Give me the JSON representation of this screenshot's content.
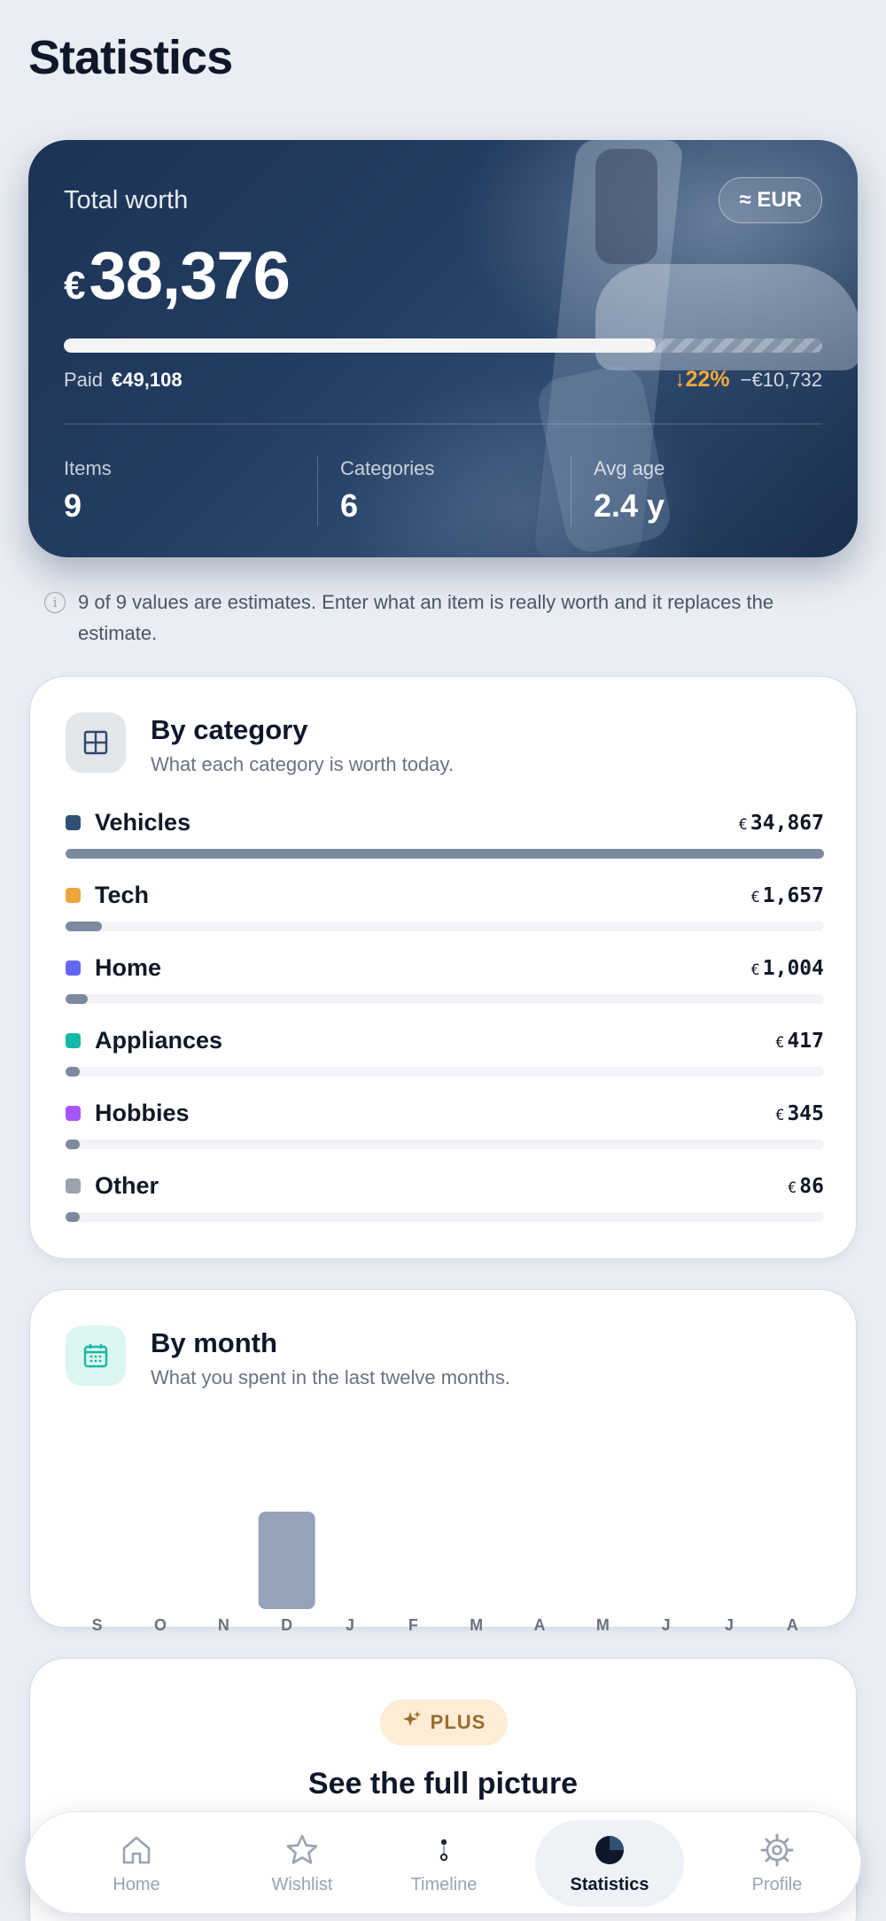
{
  "page": {
    "title": "Statistics"
  },
  "hero": {
    "label": "Total worth",
    "currency_chip": "≈ EUR",
    "currency_symbol": "€",
    "value": "38,376",
    "progress_fraction": 0.78,
    "paid_label": "Paid",
    "paid_value": "€49,108",
    "delta_pct": "↓22%",
    "delta_amount": "−€10,732",
    "stats": [
      {
        "label": "Items",
        "value": "9"
      },
      {
        "label": "Categories",
        "value": "6"
      },
      {
        "label": "Avg age",
        "value": "2.4 y"
      }
    ]
  },
  "note": "9 of 9 values are estimates. Enter what an item is really worth and it replaces the estimate.",
  "by_category": {
    "title": "By category",
    "subtitle": "What each category is worth today.",
    "currency_symbol": "€",
    "items": [
      {
        "name": "Vehicles",
        "value": "34,867",
        "color": "#2f5175",
        "share": 1.0
      },
      {
        "name": "Tech",
        "value": "1,657",
        "color": "#f0a43c",
        "share": 0.048
      },
      {
        "name": "Home",
        "value": "1,004",
        "color": "#6366f1",
        "share": 0.029
      },
      {
        "name": "Appliances",
        "value": "417",
        "color": "#14b8a6",
        "share": 0.012
      },
      {
        "name": "Hobbies",
        "value": "345",
        "color": "#a855f7",
        "share": 0.01
      },
      {
        "name": "Other",
        "value": "86",
        "color": "#9ca3af",
        "share": 0.0025
      }
    ]
  },
  "by_month": {
    "title": "By month",
    "subtitle": "What you spent in the last twelve months.",
    "chart_data": {
      "type": "bar",
      "categories": [
        "S",
        "O",
        "N",
        "D",
        "J",
        "F",
        "M",
        "A",
        "M",
        "J",
        "J",
        "A"
      ],
      "values": [
        0,
        0,
        0,
        1,
        0,
        0,
        0,
        0,
        0,
        0,
        0,
        0
      ],
      "title": "",
      "xlabel": "",
      "ylabel": "",
      "grid": false
    }
  },
  "plus": {
    "badge": "PLUS",
    "title": "See the full picture"
  },
  "tabbar": {
    "tabs": [
      {
        "label": "Home",
        "icon": "home-icon"
      },
      {
        "label": "Wishlist",
        "icon": "star-icon"
      },
      {
        "label": "Timeline",
        "icon": "timeline-icon"
      },
      {
        "label": "Statistics",
        "icon": "pie-chart-icon",
        "active": true
      },
      {
        "label": "Profile",
        "icon": "gear-icon"
      }
    ]
  }
}
